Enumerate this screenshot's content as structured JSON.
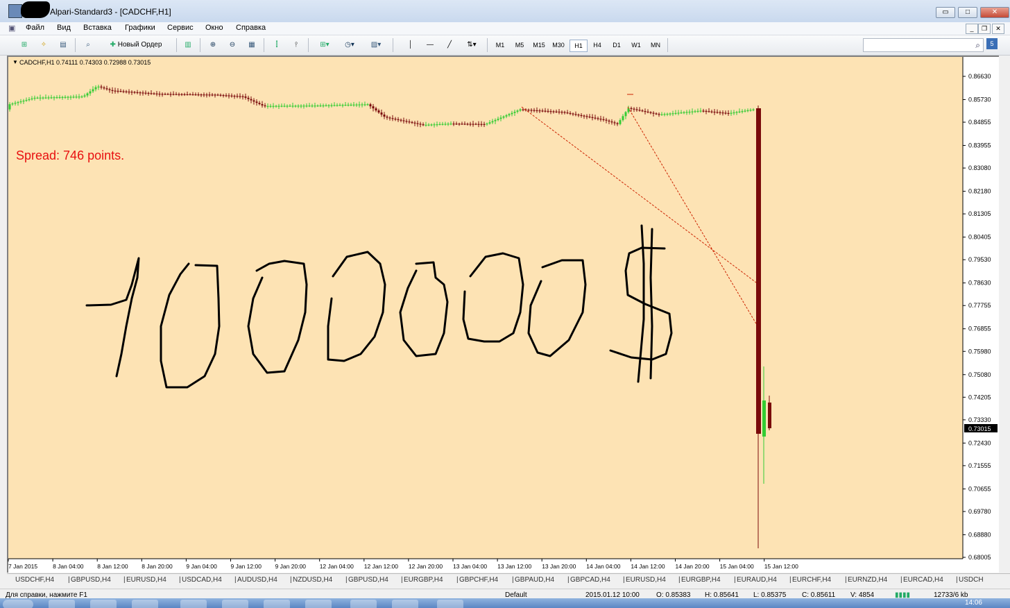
{
  "window": {
    "title": "Alpari-Standard3 - [CADCHF,H1]",
    "btn_min": "▭",
    "btn_max": "□",
    "btn_close": "✕"
  },
  "menu": {
    "items": [
      "Файл",
      "Вид",
      "Вставка",
      "Графики",
      "Сервис",
      "Окно",
      "Справка"
    ]
  },
  "toolbar": {
    "new_order": "Новый Ордер",
    "timeframes": [
      "M1",
      "M5",
      "M15",
      "M30",
      "H1",
      "H4",
      "D1",
      "W1",
      "MN"
    ],
    "active_timeframe": "H1",
    "search_placeholder": "",
    "badge": "5"
  },
  "chart": {
    "header": "CADCHF,H1  0.74111 0.74303 0.72988 0.73015",
    "spread_text": "Spread: 746 points.",
    "current_price": "0.73015",
    "price_labels": [
      "0.86630",
      "0.85730",
      "0.84855",
      "0.83955",
      "0.83080",
      "0.82180",
      "0.81305",
      "0.80405",
      "0.79530",
      "0.78630",
      "0.77755",
      "0.76855",
      "0.75980",
      "0.75080",
      "0.74205",
      "0.73330",
      "0.72430",
      "0.71555",
      "0.70655",
      "0.69780",
      "0.68880",
      "0.68005"
    ],
    "time_labels": [
      "7 Jan 2015",
      "8 Jan 04:00",
      "8 Jan 12:00",
      "8 Jan 20:00",
      "9 Jan 04:00",
      "9 Jan 12:00",
      "9 Jan 20:00",
      "12 Jan 04:00",
      "12 Jan 12:00",
      "12 Jan 20:00",
      "13 Jan 04:00",
      "13 Jan 12:00",
      "13 Jan 20:00",
      "14 Jan 04:00",
      "14 Jan 12:00",
      "14 Jan 20:00",
      "15 Jan 04:00",
      "15 Jan 12:00"
    ],
    "background": "#fde3b4",
    "bull_color": "#33cc33",
    "bear_color": "#7a0a0a",
    "chart_data": {
      "type": "candlestick",
      "symbol": "CADCHF",
      "timeframe": "H1",
      "ylim": [
        0.68005,
        0.8663
      ],
      "last_candle": {
        "open": 0.74111,
        "high": 0.74303,
        "low": 0.72988,
        "close": 0.73015
      },
      "crash": {
        "open": 0.855,
        "high": 0.856,
        "low": 0.684,
        "close": 0.728
      }
    }
  },
  "symbol_tabs": [
    "USDCHF,H4",
    "GBPUSD,H4",
    "EURUSD,H4",
    "USDCAD,H4",
    "AUDUSD,H4",
    "NZDUSD,H4",
    "GBPUSD,H4",
    "EURGBP,H4",
    "GBPCHF,H4",
    "GBPAUD,H4",
    "GBPCAD,H4",
    "EURUSD,H4",
    "EURGBP,H4",
    "EURAUD,H4",
    "EURCHF,H4",
    "EURNZD,H4",
    "EURCAD,H4",
    "USDCH"
  ],
  "status": {
    "help": "Для справки, нажмите F1",
    "profile": "Default",
    "datetime": "2015.01.12 10:00",
    "open": "O: 0.85383",
    "high": "H: 0.85641",
    "low": "L: 0.85375",
    "close": "C: 0.85611",
    "volume": "V: 4854",
    "traffic": "12733/6 kb"
  },
  "taskbar": {
    "clock": "14:06"
  }
}
